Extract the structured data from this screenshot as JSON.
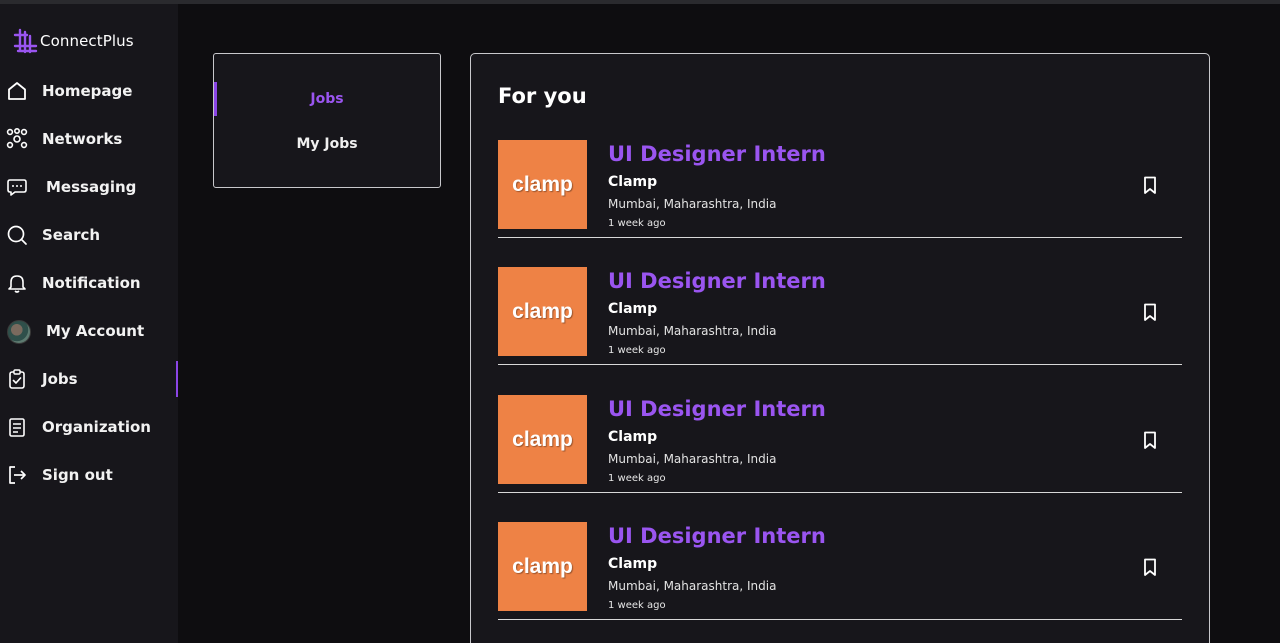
{
  "app": {
    "name": "ConnectPlus",
    "accent": "#8b45e6"
  },
  "sidebar": {
    "items": [
      {
        "label": "Homepage",
        "icon": "home-icon"
      },
      {
        "label": "Networks",
        "icon": "network-icon"
      },
      {
        "label": "Messaging",
        "icon": "chat-icon"
      },
      {
        "label": "Search",
        "icon": "search-icon"
      },
      {
        "label": "Notification",
        "icon": "bell-icon"
      },
      {
        "label": "My Account",
        "icon": "avatar"
      },
      {
        "label": "Jobs",
        "icon": "clipboard-check-icon",
        "active": true
      },
      {
        "label": "Organization",
        "icon": "document-list-icon"
      },
      {
        "label": "Sign out",
        "icon": "sign-out-icon"
      }
    ]
  },
  "tabs": [
    {
      "label": "Jobs",
      "active": true
    },
    {
      "label": "My Jobs",
      "active": false
    }
  ],
  "main": {
    "title": "For you",
    "jobs": [
      {
        "logo_text": "clamp",
        "title": "UI Designer Intern",
        "company": "Clamp",
        "location": "Mumbai, Maharashtra, India",
        "posted": "1 week ago"
      },
      {
        "logo_text": "clamp",
        "title": "UI Designer Intern",
        "company": "Clamp",
        "location": "Mumbai, Maharashtra, India",
        "posted": "1 week ago"
      },
      {
        "logo_text": "clamp",
        "title": "UI Designer Intern",
        "company": "Clamp",
        "location": "Mumbai, Maharashtra, India",
        "posted": "1 week ago"
      },
      {
        "logo_text": "clamp",
        "title": "UI Designer Intern",
        "company": "Clamp",
        "location": "Mumbai, Maharashtra, India",
        "posted": "1 week ago"
      }
    ]
  }
}
